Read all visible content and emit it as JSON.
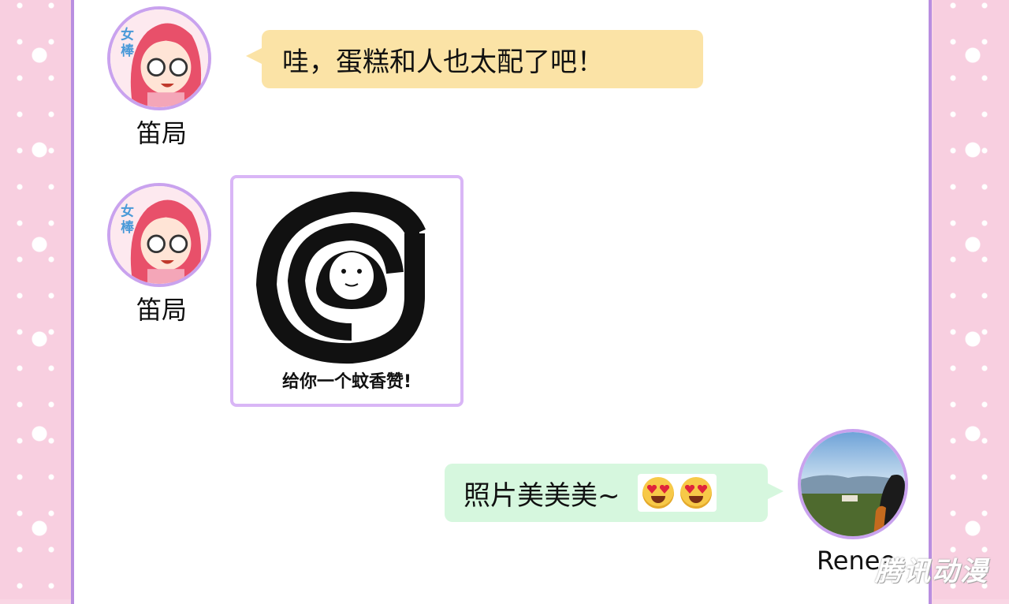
{
  "messages": [
    {
      "sender": "笛局",
      "type": "text",
      "text": "哇，蛋糕和人也太配了吧！"
    },
    {
      "sender": "笛局",
      "type": "sticker",
      "caption": "给你一个蚊香赞!"
    },
    {
      "sender": "Renee",
      "type": "text",
      "text": "照片美美美~",
      "emoji": [
        "heart-eyes-emoji",
        "heart-eyes-emoji"
      ]
    }
  ],
  "watermark": "腾讯动漫",
  "colors": {
    "frame": "#b98ee0",
    "left_bubble": "#fbe3a6",
    "right_bubble": "#d6f7de",
    "side_pink": "#f8cfe0"
  }
}
